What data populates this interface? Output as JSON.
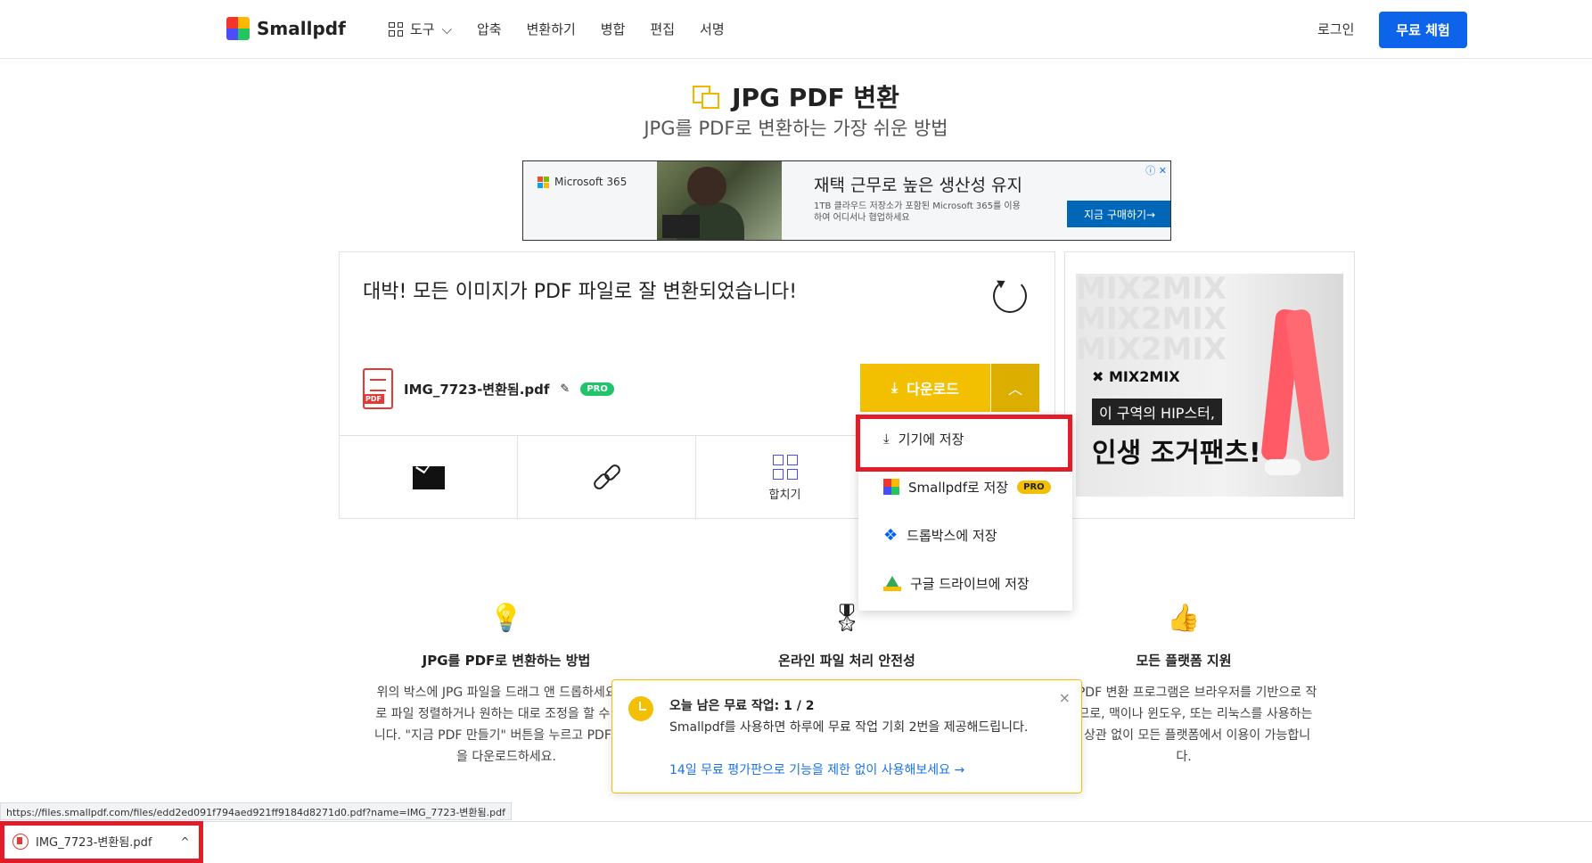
{
  "header": {
    "logo_text": "Smallpdf",
    "nav_tools": "도구",
    "nav_items": [
      "압축",
      "변환하기",
      "병합",
      "편집",
      "서명"
    ],
    "login": "로그인",
    "trial": "무료 체험"
  },
  "hero": {
    "title": "JPG PDF 변환",
    "subtitle": "JPG를 PDF로 변환하는 가장 쉬운 방법"
  },
  "ad_top": {
    "brand": "Microsoft 365",
    "headline": "재택 근무로 높은 생산성 유지",
    "desc": "1TB 클라우드 저장소가 포함된 Microsoft 365를 이용하여 어디서나 협업하세요",
    "cta": "지금 구매하기→",
    "adchoice": "ⓘ ✕"
  },
  "panel": {
    "success": "대박! 모든 이미지가 PDF 파일로 잘 변환되었습니다!",
    "file_name": "IMG_7723-변환됨.pdf",
    "pro": "PRO",
    "pdf_tag": "PDF",
    "download": "다운로드",
    "merge_label": "합치기"
  },
  "dropdown": {
    "items": [
      {
        "label": "기기에 저장"
      },
      {
        "label": "Smallpdf로 저장",
        "badge": "PRO"
      },
      {
        "label": "드롭박스에 저장"
      },
      {
        "label": "구글 드라이브에 저장"
      }
    ]
  },
  "ad_right": {
    "brand": "MIX2MIX",
    "tag": "이 구역의 HIP스터,",
    "big": "인생 조거팬츠!",
    "watermark": "MIX2MIX"
  },
  "features": [
    {
      "title": "JPG를 PDF로 변환하는 방법",
      "text": "위의 박스에 JPG 파일을 드래그 앤 드롭하세요. 바로 파일 정렬하거나 원하는 대로 조정을 할 수 있습니다. \"지금 PDF 만들기\" 버튼을 누르고 PDF 파일을 다운로드하세요."
    },
    {
      "title": "온라인 파일 처리 안전성",
      "text": ""
    },
    {
      "title": "모든 플랫폼 지원",
      "text": "저희 PDF 변환 프로그램은 브라우저를 기반으로 작동하므로, 맥이나 윈도우, 또는 리눅스를 사용하는지와 상관 없이 모든 플랫폼에서 이용이 가능합니다."
    }
  ],
  "toast": {
    "title": "오늘 남은 무료 작업: 1 / 2",
    "body": "Smallpdf를 사용하면 하루에 무료 작업 기회 2번을 제공해드립니다.",
    "link": "14일 무료 평가판으로 기능을 제한 없이 사용해보세요 →",
    "close": "×"
  },
  "status_url": "https://files.smallpdf.com/files/edd2ed091f794aed921ff9184d8271d0.pdf?name=IMG_7723-변환됨.pdf",
  "download_shelf": {
    "file": "IMG_7723-변환됨.pdf",
    "caret": "^"
  }
}
